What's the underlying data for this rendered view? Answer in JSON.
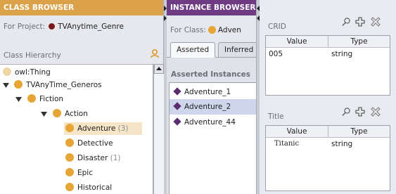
{
  "class_browser": {
    "header": "CLASS BROWSER",
    "for_project_label": "For Project:",
    "project_name": "TVAnytime_Genre",
    "class_hierarchy_label": "Class Hierarchy",
    "tree": [
      {
        "label": "owl:Thing",
        "count": ""
      },
      {
        "label": "TVAnyTime_Generos",
        "count": ""
      },
      {
        "label": "Fiction",
        "count": ""
      },
      {
        "label": "Action",
        "count": ""
      },
      {
        "label": "Adventure",
        "count": "(3)"
      },
      {
        "label": "Detective",
        "count": ""
      },
      {
        "label": "Disaster",
        "count": "(1)"
      },
      {
        "label": "Epic",
        "count": ""
      },
      {
        "label": "Historical",
        "count": ""
      }
    ]
  },
  "instance_browser": {
    "header": "INSTANCE BROWSER",
    "for_class_label": "For Class:",
    "class_name": "Adven",
    "tabs": [
      "Asserted",
      "Inferred"
    ],
    "asserted_label": "Asserted Instances",
    "instances": [
      "Adventure_1",
      "Adventure_2",
      "Adventure_44"
    ]
  },
  "properties": {
    "crid": {
      "title": "CRID",
      "columns": [
        "Value",
        "Type"
      ],
      "rows": [
        {
          "value": "005",
          "type": "string"
        }
      ]
    },
    "title": {
      "title": "Title",
      "columns": [
        "Value",
        "Type"
      ],
      "rows": [
        {
          "value": "Titanic",
          "type": "string"
        }
      ]
    }
  },
  "colors": {
    "class_header": "#dca24a",
    "instance_header": "#6f3c84",
    "class_dot": "#e6a534",
    "project_dot": "#7a1818",
    "instance_diamond": "#5b2c6f",
    "selection_class": "#f6e5c6",
    "selection_instance": "#cdd6ea"
  }
}
